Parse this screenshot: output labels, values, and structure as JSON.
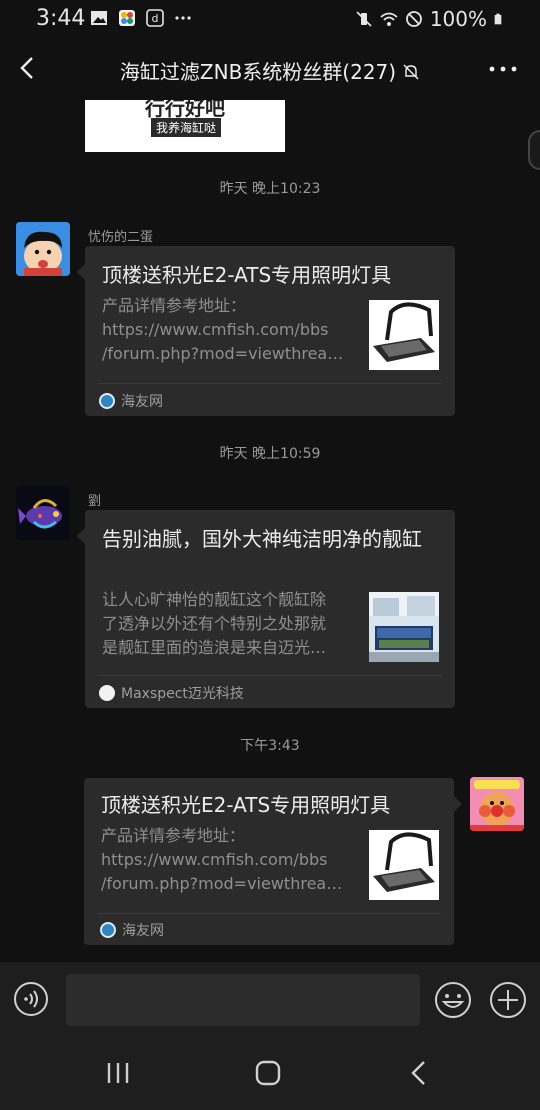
{
  "status_bar": {
    "time": "3:44",
    "battery": "100%"
  },
  "header": {
    "title": "海缸过滤ZNB系统粉丝群(227)"
  },
  "image_message": {
    "big_text": "行行好吧",
    "caption": "我养海缸哒"
  },
  "timestamps": [
    "昨天 晚上10:23",
    "昨天 晚上10:59",
    "下午3:43"
  ],
  "messages": [
    {
      "sender": "忧伤的二蛋",
      "title": "顶楼送积光E2-ATS专用照明灯具",
      "desc": "产品详情参考地址：\nhttps://www.cmfish.com/bbs\n/forum.php?mod=viewthrea…",
      "source": "海友网"
    },
    {
      "sender": "劉",
      "title": "告别油腻，国外大神纯洁明净的靓缸",
      "desc": "让人心旷神怡的靓缸这个靓缸除\n了透净以外还有个特别之处那就\n是靓缸里面的造浪是来自迈光…",
      "source": "Maxspect迈光科技"
    },
    {
      "sender": "",
      "title": "顶楼送积光E2-ATS专用照明灯具",
      "desc": "产品详情参考地址：\nhttps://www.cmfish.com/bbs\n/forum.php?mod=viewthrea…",
      "source": "海友网"
    }
  ],
  "colors": {
    "background": "#111111",
    "card": "#2b2b2b",
    "muted_text": "#9a9a9a",
    "accent_blue": "#3aa0ff"
  },
  "icons": [
    "back-arrow-icon",
    "mute-bell-icon",
    "more-dots-icon",
    "voice-icon",
    "emoji-icon",
    "plus-icon",
    "recents-icon",
    "home-icon",
    "nav-back-icon"
  ]
}
